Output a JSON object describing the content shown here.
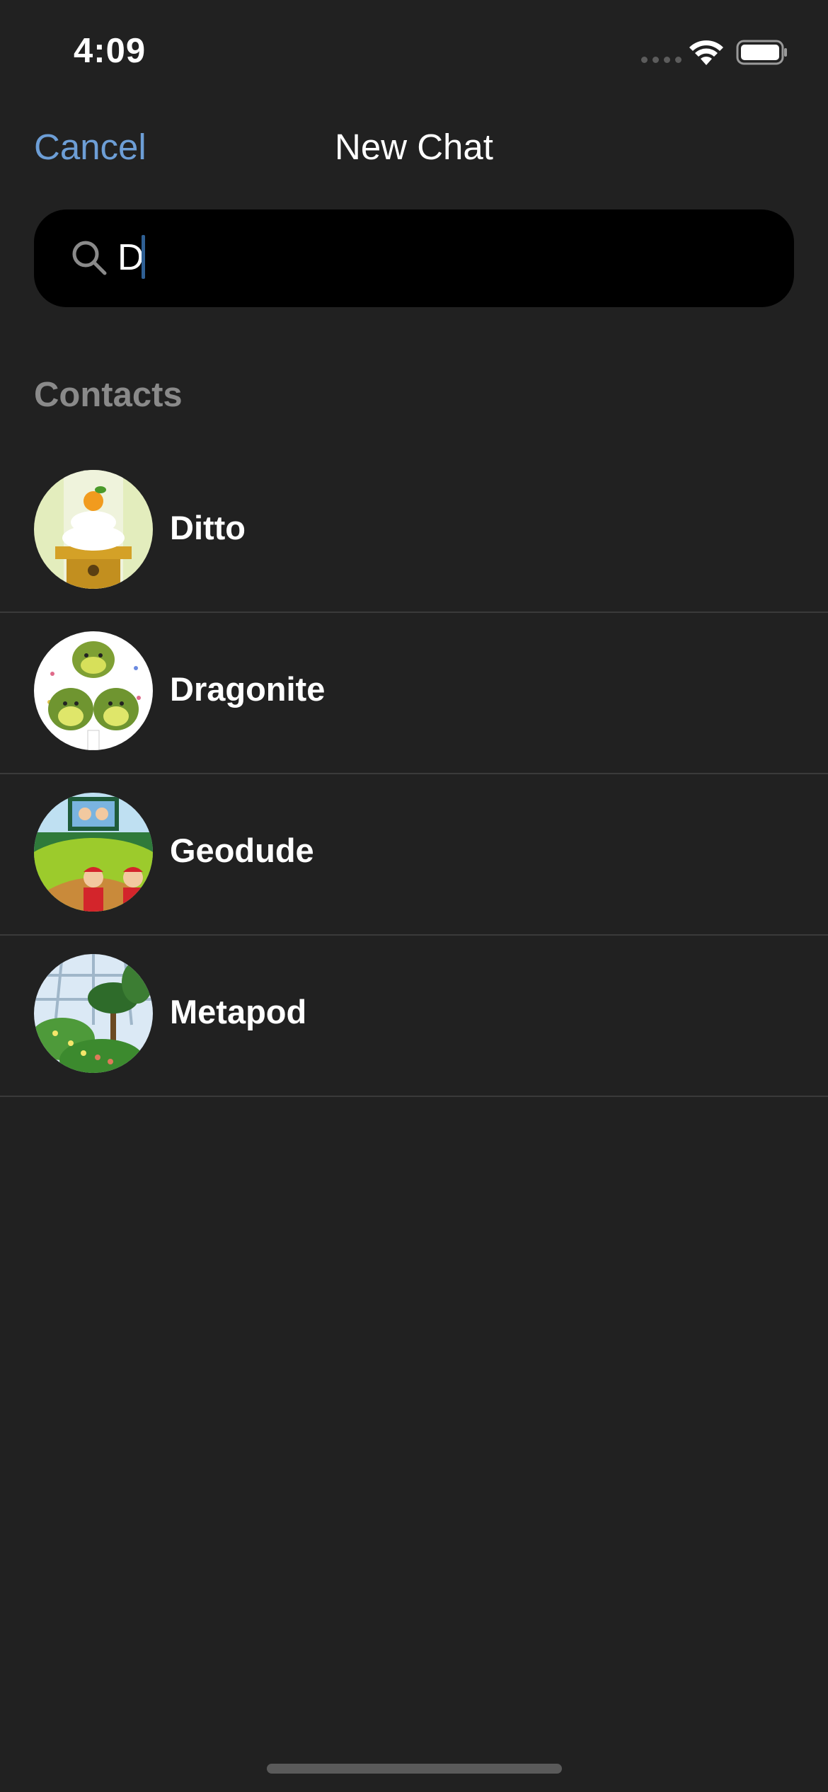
{
  "status_bar": {
    "time": "4:09",
    "signal_icon": "cellular-signal-icon",
    "wifi_icon": "wifi-icon",
    "battery_icon": "battery-icon"
  },
  "nav": {
    "cancel_label": "Cancel",
    "title": "New Chat"
  },
  "search": {
    "value": "D",
    "icon": "search-icon"
  },
  "contacts": {
    "header": "Contacts",
    "items": [
      {
        "name": "Ditto",
        "avatar": "kagami-mochi-avatar"
      },
      {
        "name": "Dragonite",
        "avatar": "dragons-avatar"
      },
      {
        "name": "Geodude",
        "avatar": "stadium-avatar"
      },
      {
        "name": "Metapod",
        "avatar": "greenhouse-avatar"
      }
    ]
  },
  "colors": {
    "background": "#212121",
    "accent": "#6d9ed6",
    "search_background": "#000000",
    "section_header": "#8a8a8a",
    "separator": "#3a3a3a"
  }
}
